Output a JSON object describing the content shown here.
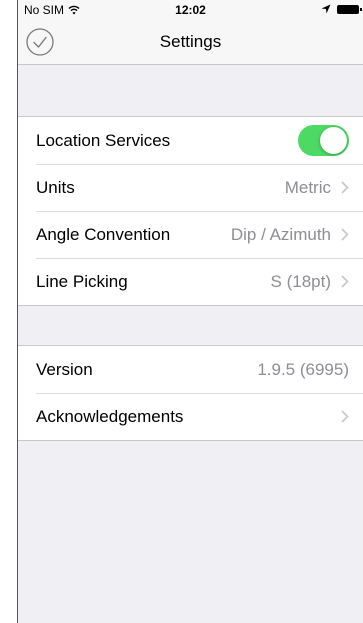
{
  "colors": {
    "switch_on": "#4cd964",
    "group_background": "#efeff4",
    "secondary_text": "#8e8e93"
  },
  "status_bar": {
    "carrier": "No SIM",
    "time": "12:02",
    "icons": [
      "wifi-icon",
      "location-arrow-icon",
      "battery-icon"
    ]
  },
  "nav": {
    "title": "Settings",
    "done_icon": "checkmark-circle-icon"
  },
  "settings_group": [
    {
      "label": "Location Services",
      "type": "toggle",
      "on": true
    },
    {
      "label": "Units",
      "value": "Metric",
      "type": "disclosure"
    },
    {
      "label": "Angle Convention",
      "value": "Dip / Azimuth",
      "type": "disclosure"
    },
    {
      "label": "Line Picking",
      "value": "S (18pt)",
      "type": "disclosure"
    }
  ],
  "info_group": [
    {
      "label": "Version",
      "value": "1.9.5 (6995)",
      "type": "value"
    },
    {
      "label": "Acknowledgements",
      "type": "disclosure"
    }
  ]
}
